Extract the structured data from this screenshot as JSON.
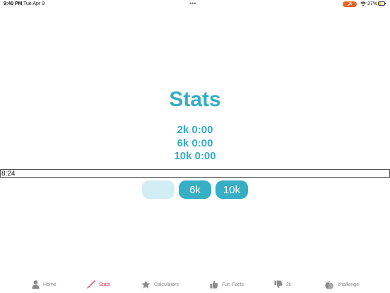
{
  "status_bar": {
    "time": "9:40 PM",
    "date": "Tue Apr 9",
    "dots": "•••",
    "battery_pct": "37%",
    "battery_level": 0.37
  },
  "main": {
    "title": "Stats",
    "times": [
      "2k 0:00",
      "6k 0:00",
      "10k 0:00"
    ],
    "input_value": "8:24",
    "buttons": [
      {
        "label": "2k",
        "disabled": true
      },
      {
        "label": "6k",
        "disabled": false
      },
      {
        "label": "10k",
        "disabled": false
      }
    ]
  },
  "tab_bar": {
    "items": [
      {
        "label": "Home",
        "icon": "person-icon"
      },
      {
        "label": "Stats",
        "icon": "stats-pencil-icon",
        "active": true
      },
      {
        "label": "Calculators",
        "icon": "star-icon"
      },
      {
        "label": "Fun Facts",
        "icon": "thumbs-up-icon"
      },
      {
        "label": "2k",
        "icon": "thumbs-down-icon"
      },
      {
        "label": "challenge",
        "icon": "clapping-hands-icon"
      }
    ]
  },
  "colors": {
    "accent": "#36aec4",
    "accent_disabled": "#d2edf3",
    "tab_active": "#e8334f",
    "tab_inactive": "#888888",
    "record_indicator": "#e8652b"
  }
}
